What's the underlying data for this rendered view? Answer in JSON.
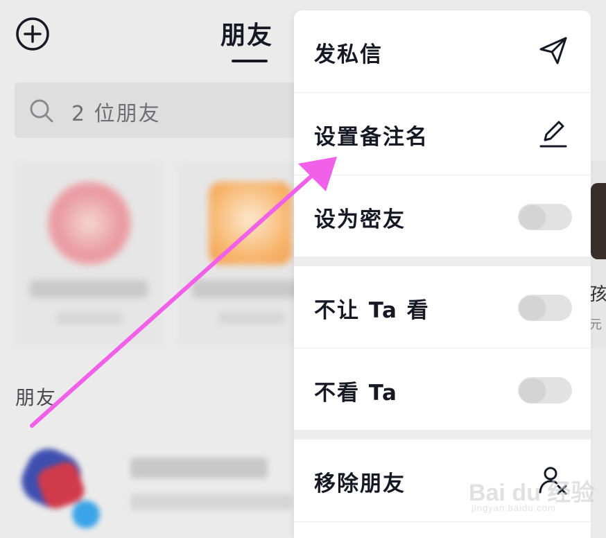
{
  "header": {
    "title": "朋友"
  },
  "search": {
    "placeholder": "2 位朋友"
  },
  "recommend_cards": [
    {},
    {}
  ],
  "right_peek": {
    "text_1": "孩",
    "text_2": "元"
  },
  "friends_section": {
    "label": "朋友"
  },
  "menu": {
    "items": [
      {
        "label": "发私信",
        "icon": "send-icon"
      },
      {
        "label": "设置备注名",
        "icon": "pencil-icon"
      },
      {
        "label": "设为密友",
        "toggle": false
      },
      {
        "label": "不让 Ta 看",
        "toggle": false
      },
      {
        "label": "不看 Ta",
        "toggle": false
      },
      {
        "label": "移除朋友",
        "icon": "remove-user-icon"
      }
    ]
  },
  "watermark": {
    "main": "Bai du 经验",
    "url": "jingyan.baidu.com"
  },
  "colors": {
    "arrow": "#f060e8",
    "text": "#161823",
    "background": "#ebebeb"
  }
}
